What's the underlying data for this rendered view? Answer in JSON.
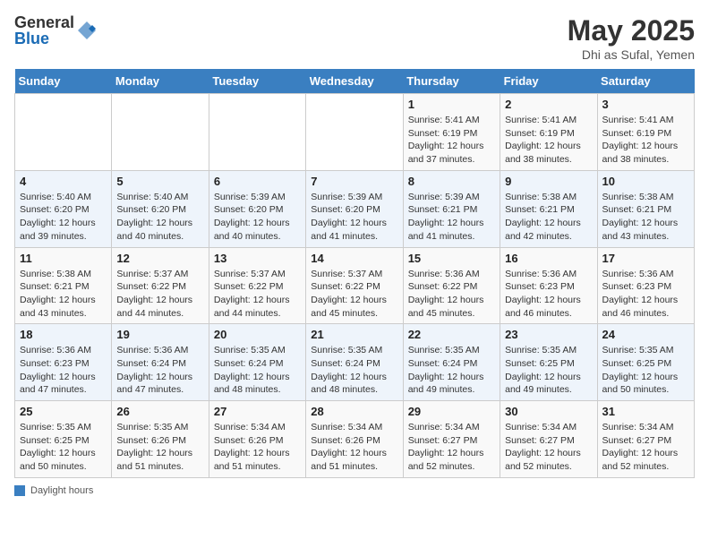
{
  "header": {
    "logo_general": "General",
    "logo_blue": "Blue",
    "title": "May 2025",
    "subtitle": "Dhi as Sufal, Yemen"
  },
  "weekdays": [
    "Sunday",
    "Monday",
    "Tuesday",
    "Wednesday",
    "Thursday",
    "Friday",
    "Saturday"
  ],
  "weeks": [
    [
      {
        "day": "",
        "detail": ""
      },
      {
        "day": "",
        "detail": ""
      },
      {
        "day": "",
        "detail": ""
      },
      {
        "day": "",
        "detail": ""
      },
      {
        "day": "1",
        "detail": "Sunrise: 5:41 AM\nSunset: 6:19 PM\nDaylight: 12 hours\nand 37 minutes."
      },
      {
        "day": "2",
        "detail": "Sunrise: 5:41 AM\nSunset: 6:19 PM\nDaylight: 12 hours\nand 38 minutes."
      },
      {
        "day": "3",
        "detail": "Sunrise: 5:41 AM\nSunset: 6:19 PM\nDaylight: 12 hours\nand 38 minutes."
      }
    ],
    [
      {
        "day": "4",
        "detail": "Sunrise: 5:40 AM\nSunset: 6:20 PM\nDaylight: 12 hours\nand 39 minutes."
      },
      {
        "day": "5",
        "detail": "Sunrise: 5:40 AM\nSunset: 6:20 PM\nDaylight: 12 hours\nand 40 minutes."
      },
      {
        "day": "6",
        "detail": "Sunrise: 5:39 AM\nSunset: 6:20 PM\nDaylight: 12 hours\nand 40 minutes."
      },
      {
        "day": "7",
        "detail": "Sunrise: 5:39 AM\nSunset: 6:20 PM\nDaylight: 12 hours\nand 41 minutes."
      },
      {
        "day": "8",
        "detail": "Sunrise: 5:39 AM\nSunset: 6:21 PM\nDaylight: 12 hours\nand 41 minutes."
      },
      {
        "day": "9",
        "detail": "Sunrise: 5:38 AM\nSunset: 6:21 PM\nDaylight: 12 hours\nand 42 minutes."
      },
      {
        "day": "10",
        "detail": "Sunrise: 5:38 AM\nSunset: 6:21 PM\nDaylight: 12 hours\nand 43 minutes."
      }
    ],
    [
      {
        "day": "11",
        "detail": "Sunrise: 5:38 AM\nSunset: 6:21 PM\nDaylight: 12 hours\nand 43 minutes."
      },
      {
        "day": "12",
        "detail": "Sunrise: 5:37 AM\nSunset: 6:22 PM\nDaylight: 12 hours\nand 44 minutes."
      },
      {
        "day": "13",
        "detail": "Sunrise: 5:37 AM\nSunset: 6:22 PM\nDaylight: 12 hours\nand 44 minutes."
      },
      {
        "day": "14",
        "detail": "Sunrise: 5:37 AM\nSunset: 6:22 PM\nDaylight: 12 hours\nand 45 minutes."
      },
      {
        "day": "15",
        "detail": "Sunrise: 5:36 AM\nSunset: 6:22 PM\nDaylight: 12 hours\nand 45 minutes."
      },
      {
        "day": "16",
        "detail": "Sunrise: 5:36 AM\nSunset: 6:23 PM\nDaylight: 12 hours\nand 46 minutes."
      },
      {
        "day": "17",
        "detail": "Sunrise: 5:36 AM\nSunset: 6:23 PM\nDaylight: 12 hours\nand 46 minutes."
      }
    ],
    [
      {
        "day": "18",
        "detail": "Sunrise: 5:36 AM\nSunset: 6:23 PM\nDaylight: 12 hours\nand 47 minutes."
      },
      {
        "day": "19",
        "detail": "Sunrise: 5:36 AM\nSunset: 6:24 PM\nDaylight: 12 hours\nand 47 minutes."
      },
      {
        "day": "20",
        "detail": "Sunrise: 5:35 AM\nSunset: 6:24 PM\nDaylight: 12 hours\nand 48 minutes."
      },
      {
        "day": "21",
        "detail": "Sunrise: 5:35 AM\nSunset: 6:24 PM\nDaylight: 12 hours\nand 48 minutes."
      },
      {
        "day": "22",
        "detail": "Sunrise: 5:35 AM\nSunset: 6:24 PM\nDaylight: 12 hours\nand 49 minutes."
      },
      {
        "day": "23",
        "detail": "Sunrise: 5:35 AM\nSunset: 6:25 PM\nDaylight: 12 hours\nand 49 minutes."
      },
      {
        "day": "24",
        "detail": "Sunrise: 5:35 AM\nSunset: 6:25 PM\nDaylight: 12 hours\nand 50 minutes."
      }
    ],
    [
      {
        "day": "25",
        "detail": "Sunrise: 5:35 AM\nSunset: 6:25 PM\nDaylight: 12 hours\nand 50 minutes."
      },
      {
        "day": "26",
        "detail": "Sunrise: 5:35 AM\nSunset: 6:26 PM\nDaylight: 12 hours\nand 51 minutes."
      },
      {
        "day": "27",
        "detail": "Sunrise: 5:34 AM\nSunset: 6:26 PM\nDaylight: 12 hours\nand 51 minutes."
      },
      {
        "day": "28",
        "detail": "Sunrise: 5:34 AM\nSunset: 6:26 PM\nDaylight: 12 hours\nand 51 minutes."
      },
      {
        "day": "29",
        "detail": "Sunrise: 5:34 AM\nSunset: 6:27 PM\nDaylight: 12 hours\nand 52 minutes."
      },
      {
        "day": "30",
        "detail": "Sunrise: 5:34 AM\nSunset: 6:27 PM\nDaylight: 12 hours\nand 52 minutes."
      },
      {
        "day": "31",
        "detail": "Sunrise: 5:34 AM\nSunset: 6:27 PM\nDaylight: 12 hours\nand 52 minutes."
      }
    ]
  ],
  "legend": {
    "label": "Daylight hours"
  }
}
